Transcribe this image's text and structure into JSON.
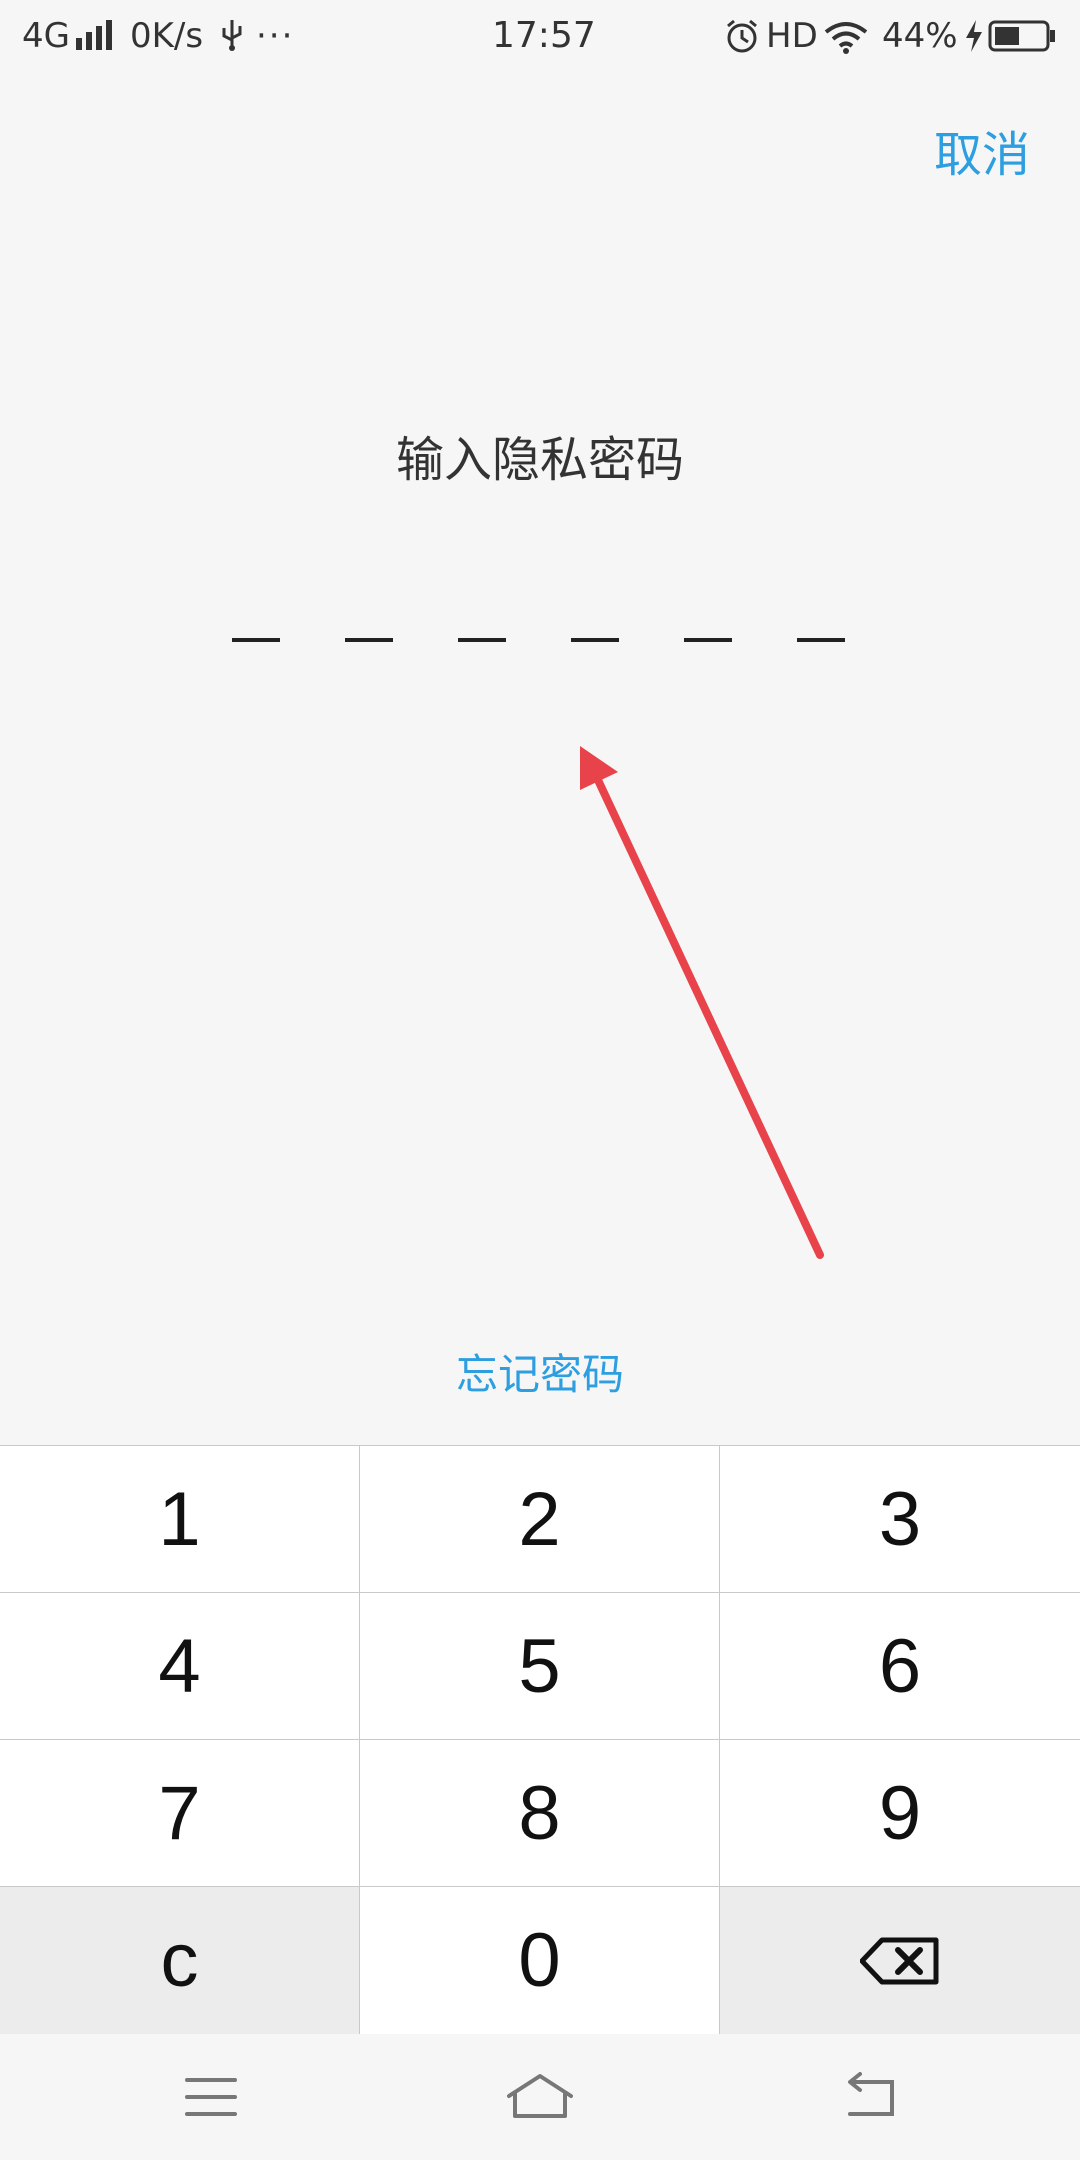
{
  "status_bar": {
    "network": "4G",
    "speed": "0K/s",
    "dots": "···",
    "time": "17:57",
    "hd": "HD",
    "battery_pct": "44%"
  },
  "header": {
    "cancel_label": "取消",
    "title": "输入隐私密码"
  },
  "pin": {
    "length": 6,
    "entered": 0
  },
  "forgot_label": "忘记密码",
  "keypad": {
    "keys": [
      "1",
      "2",
      "3",
      "4",
      "5",
      "6",
      "7",
      "8",
      "9",
      "c",
      "0"
    ],
    "delete_icon": "backspace-icon"
  },
  "nav": {
    "menu_icon": "menu-icon",
    "home_icon": "home-icon",
    "back_icon": "back-icon"
  },
  "colors": {
    "accent": "#2d9ee0",
    "annotation_arrow": "#e8434a"
  }
}
